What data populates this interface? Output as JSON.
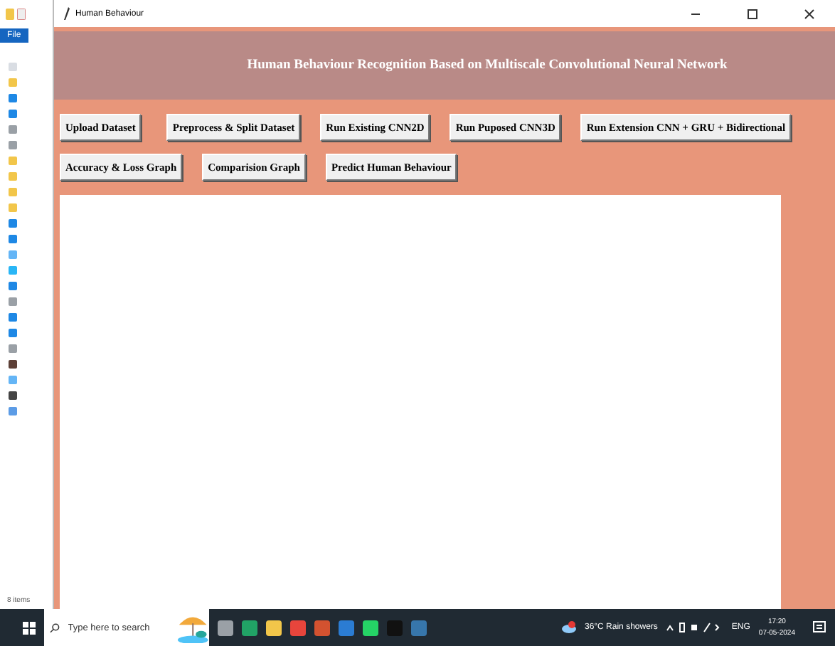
{
  "explorer": {
    "ribbon_tab": "File",
    "status": "8 items"
  },
  "window": {
    "title": "Human Behaviour",
    "heading": "Human Behaviour Recognition Based on Multiscale Convolutional Neural Network"
  },
  "button_rows": [
    [
      "Upload Dataset",
      "Preprocess & Split Dataset",
      "Run Existing CNN2D",
      "Run Puposed CNN3D",
      "Run Extension CNN + GRU + Bidirectional"
    ],
    [
      "Accuracy & Loss Graph",
      "Comparision Graph",
      "Predict Human Behaviour"
    ]
  ],
  "taskbar": {
    "search_placeholder": "Type here to search",
    "weather": "36°C  Rain showers",
    "language": "ENG",
    "time": "17:20",
    "date": "07-05-2024"
  }
}
